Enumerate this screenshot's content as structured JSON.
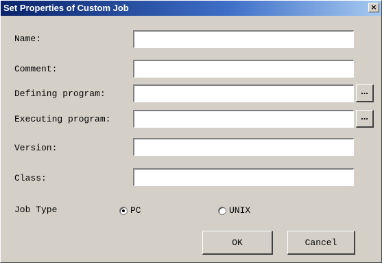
{
  "window": {
    "title": "Set Properties of Custom Job",
    "close_glyph": "×"
  },
  "form": {
    "name_label": "Name:",
    "comment_label": "Comment:",
    "defining_label": "Defining program:",
    "executing_label": "Executing program:",
    "version_label": "Version:",
    "class_label": "Class:",
    "name_value": "",
    "comment_value": "",
    "defining_value": "",
    "executing_value": "",
    "version_value": "",
    "class_value": "",
    "browse_label": "...",
    "job_type_label": "Job Type",
    "job_type_options": [
      "PC",
      "UNIX"
    ],
    "job_type_selected": "PC"
  },
  "buttons": {
    "ok": "OK",
    "cancel": "Cancel"
  }
}
